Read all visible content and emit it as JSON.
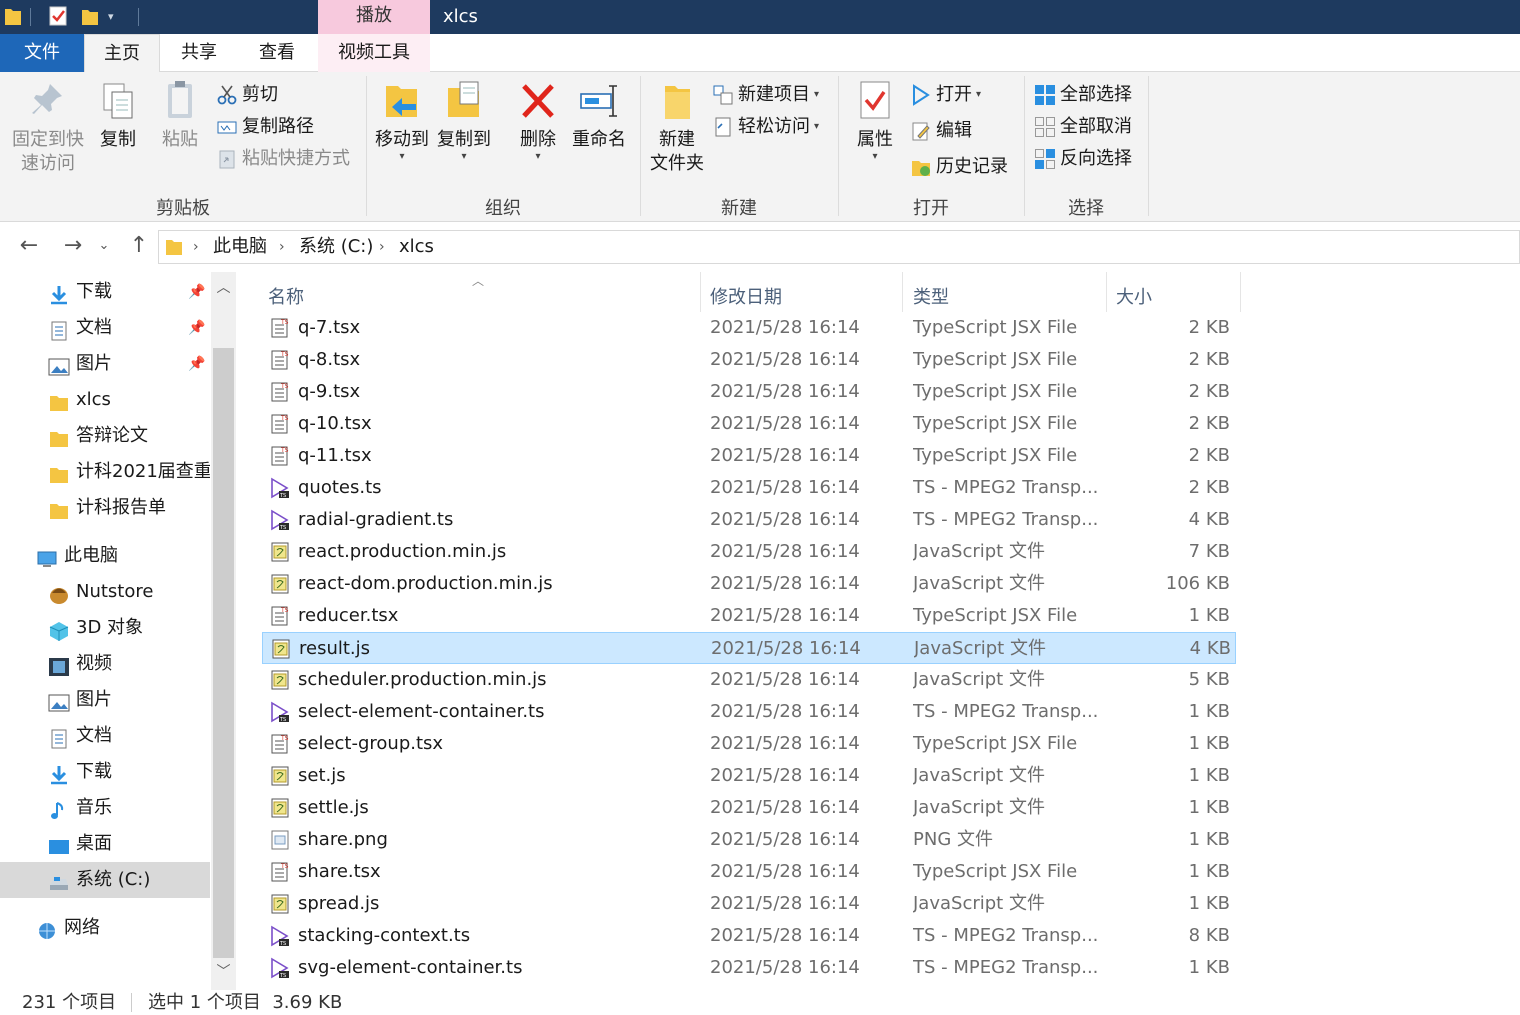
{
  "title_bar": {
    "window_title": "xlcs",
    "context_tab": "播放"
  },
  "tabs": {
    "file": "文件",
    "home": "主页",
    "share": "共享",
    "view": "查看",
    "video_tools": "视频工具"
  },
  "ribbon": {
    "clipboard": {
      "group": "剪贴板",
      "pin_quick_access": [
        "固定到快",
        "速访问"
      ],
      "copy": "复制",
      "paste": "粘贴",
      "cut": "剪切",
      "copy_path": "复制路径",
      "paste_shortcut": "粘贴快捷方式"
    },
    "organize": {
      "group": "组织",
      "move_to": "移动到",
      "copy_to": "复制到",
      "delete": "删除",
      "rename": "重命名"
    },
    "new": {
      "group": "新建",
      "new_folder": [
        "新建",
        "文件夹"
      ],
      "new_item": "新建项目",
      "easy_access": "轻松访问"
    },
    "open": {
      "group": "打开",
      "properties": "属性",
      "open": "打开",
      "edit": "编辑",
      "history": "历史记录"
    },
    "select": {
      "group": "选择",
      "select_all": "全部选择",
      "select_none": "全部取消",
      "invert": "反向选择"
    }
  },
  "address": {
    "crumbs": [
      "此电脑",
      "系统 (C:)",
      "xlcs"
    ]
  },
  "nav": {
    "quick_access": [
      {
        "label": "下载",
        "icon": "download-arrow-icon",
        "pinned": true
      },
      {
        "label": "文档",
        "icon": "document-icon",
        "pinned": true
      },
      {
        "label": "图片",
        "icon": "pictures-icon",
        "pinned": true
      },
      {
        "label": "xlcs",
        "icon": "folder-icon",
        "pinned": false
      },
      {
        "label": "答辩论文",
        "icon": "folder-icon",
        "pinned": false
      },
      {
        "label": "计科2021届查重",
        "icon": "folder-icon",
        "pinned": false
      },
      {
        "label": "计科报告单",
        "icon": "folder-icon",
        "pinned": false
      }
    ],
    "this_pc": "此电脑",
    "pc_items": [
      {
        "label": "Nutstore",
        "icon": "nutstore-icon"
      },
      {
        "label": "3D 对象",
        "icon": "3d-objects-icon"
      },
      {
        "label": "视频",
        "icon": "videos-icon"
      },
      {
        "label": "图片",
        "icon": "pictures-icon"
      },
      {
        "label": "文档",
        "icon": "document-icon"
      },
      {
        "label": "下载",
        "icon": "download-arrow-icon"
      },
      {
        "label": "音乐",
        "icon": "music-icon"
      },
      {
        "label": "桌面",
        "icon": "desktop-icon"
      },
      {
        "label": "系统 (C:)",
        "icon": "drive-icon"
      }
    ],
    "network": "网络"
  },
  "columns": {
    "name": "名称",
    "date": "修改日期",
    "type": "类型",
    "size": "大小"
  },
  "files": [
    {
      "name": "q-7.tsx",
      "date": "2021/5/28 16:14",
      "type": "TypeScript JSX File",
      "size": "2 KB",
      "icon": "tsx"
    },
    {
      "name": "q-8.tsx",
      "date": "2021/5/28 16:14",
      "type": "TypeScript JSX File",
      "size": "2 KB",
      "icon": "tsx"
    },
    {
      "name": "q-9.tsx",
      "date": "2021/5/28 16:14",
      "type": "TypeScript JSX File",
      "size": "2 KB",
      "icon": "tsx"
    },
    {
      "name": "q-10.tsx",
      "date": "2021/5/28 16:14",
      "type": "TypeScript JSX File",
      "size": "2 KB",
      "icon": "tsx"
    },
    {
      "name": "q-11.tsx",
      "date": "2021/5/28 16:14",
      "type": "TypeScript JSX File",
      "size": "2 KB",
      "icon": "tsx"
    },
    {
      "name": "quotes.ts",
      "date": "2021/5/28 16:14",
      "type": "TS - MPEG2 Transp...",
      "size": "2 KB",
      "icon": "ts"
    },
    {
      "name": "radial-gradient.ts",
      "date": "2021/5/28 16:14",
      "type": "TS - MPEG2 Transp...",
      "size": "4 KB",
      "icon": "ts"
    },
    {
      "name": "react.production.min.js",
      "date": "2021/5/28 16:14",
      "type": "JavaScript 文件",
      "size": "7 KB",
      "icon": "js"
    },
    {
      "name": "react-dom.production.min.js",
      "date": "2021/5/28 16:14",
      "type": "JavaScript 文件",
      "size": "106 KB",
      "icon": "js"
    },
    {
      "name": "reducer.tsx",
      "date": "2021/5/28 16:14",
      "type": "TypeScript JSX File",
      "size": "1 KB",
      "icon": "tsx"
    },
    {
      "name": "result.js",
      "date": "2021/5/28 16:14",
      "type": "JavaScript 文件",
      "size": "4 KB",
      "icon": "js",
      "selected": true
    },
    {
      "name": "scheduler.production.min.js",
      "date": "2021/5/28 16:14",
      "type": "JavaScript 文件",
      "size": "5 KB",
      "icon": "js"
    },
    {
      "name": "select-element-container.ts",
      "date": "2021/5/28 16:14",
      "type": "TS - MPEG2 Transp...",
      "size": "1 KB",
      "icon": "ts"
    },
    {
      "name": "select-group.tsx",
      "date": "2021/5/28 16:14",
      "type": "TypeScript JSX File",
      "size": "1 KB",
      "icon": "tsx"
    },
    {
      "name": "set.js",
      "date": "2021/5/28 16:14",
      "type": "JavaScript 文件",
      "size": "1 KB",
      "icon": "js"
    },
    {
      "name": "settle.js",
      "date": "2021/5/28 16:14",
      "type": "JavaScript 文件",
      "size": "1 KB",
      "icon": "js"
    },
    {
      "name": "share.png",
      "date": "2021/5/28 16:14",
      "type": "PNG 文件",
      "size": "1 KB",
      "icon": "png"
    },
    {
      "name": "share.tsx",
      "date": "2021/5/28 16:14",
      "type": "TypeScript JSX File",
      "size": "1 KB",
      "icon": "tsx"
    },
    {
      "name": "spread.js",
      "date": "2021/5/28 16:14",
      "type": "JavaScript 文件",
      "size": "1 KB",
      "icon": "js"
    },
    {
      "name": "stacking-context.ts",
      "date": "2021/5/28 16:14",
      "type": "TS - MPEG2 Transp...",
      "size": "8 KB",
      "icon": "ts"
    },
    {
      "name": "svg-element-container.ts",
      "date": "2021/5/28 16:14",
      "type": "TS - MPEG2 Transp...",
      "size": "1 KB",
      "icon": "ts"
    }
  ],
  "status": {
    "count": "231 个项目",
    "selection": "选中 1 个项目  3.69 KB"
  },
  "colors": {
    "title_bar": "#1e3a5f",
    "file_tab": "#1e67b8",
    "context_tab": "#f7c9dd",
    "selection": "#cce8ff",
    "column_header_text": "#4c607a"
  }
}
